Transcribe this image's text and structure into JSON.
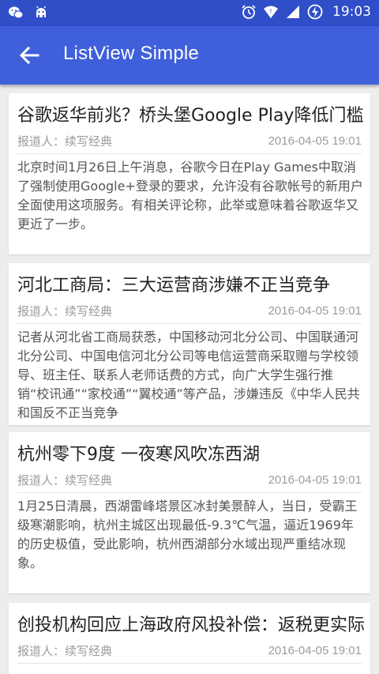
{
  "status_bar": {
    "time": "19:03",
    "left_icons": [
      "wechat-icon",
      "android-debug-icon"
    ],
    "right_icons": [
      "alarm-icon",
      "wifi-icon",
      "signal-icon",
      "battery-charging-icon"
    ]
  },
  "app_bar": {
    "title": "ListView Simple",
    "back_icon": "arrow-back-icon"
  },
  "news": [
    {
      "title": "谷歌返华前兆？桥头堡Google Play降低门槛",
      "reporter": "报道人：续写经典",
      "date": "2016-04-05 19:01",
      "body": "北京时间1月26日上午消息，谷歌今日在Play Games中取消了强制使用Google+登录的要求，允许没有谷歌帐号的新用户全面使用这项服务。有相关评论称，此举或意味着谷歌返华又更近了一步。"
    },
    {
      "title": "河北工商局：三大运营商涉嫌不正当竞争",
      "reporter": "报道人：续写经典",
      "date": "2016-04-05 19:01",
      "body": "记者从河北省工商局获悉，中国移动河北分公司、中国联通河北分公司、中国电信河北分公司等电信运营商采取赠与学校领导、班主任、联系人老师话费的方式，向广大学生强行推销“校讯通”“家校通”“翼校通”等产品，涉嫌违反《中华人民共和国反不正当竞争"
    },
    {
      "title": "杭州零下9度 一夜寒风吹冻西湖",
      "reporter": "报道人：续写经典",
      "date": "2016-04-05 19:01",
      "body": "1月25日清晨，西湖雷峰塔景区冰封美景醉人，当日，受霸王级寒潮影响，杭州主城区出现最低-9.3℃气温，逼近1969年的历史极值，受此影响，杭州西湖部分水域出现严重结冰现象。"
    },
    {
      "title": "创投机构回应上海政府风投补偿：返税更实际",
      "reporter": "报道人：续写经典",
      "date": "2016-04-05 19:01",
      "body": ""
    }
  ]
}
